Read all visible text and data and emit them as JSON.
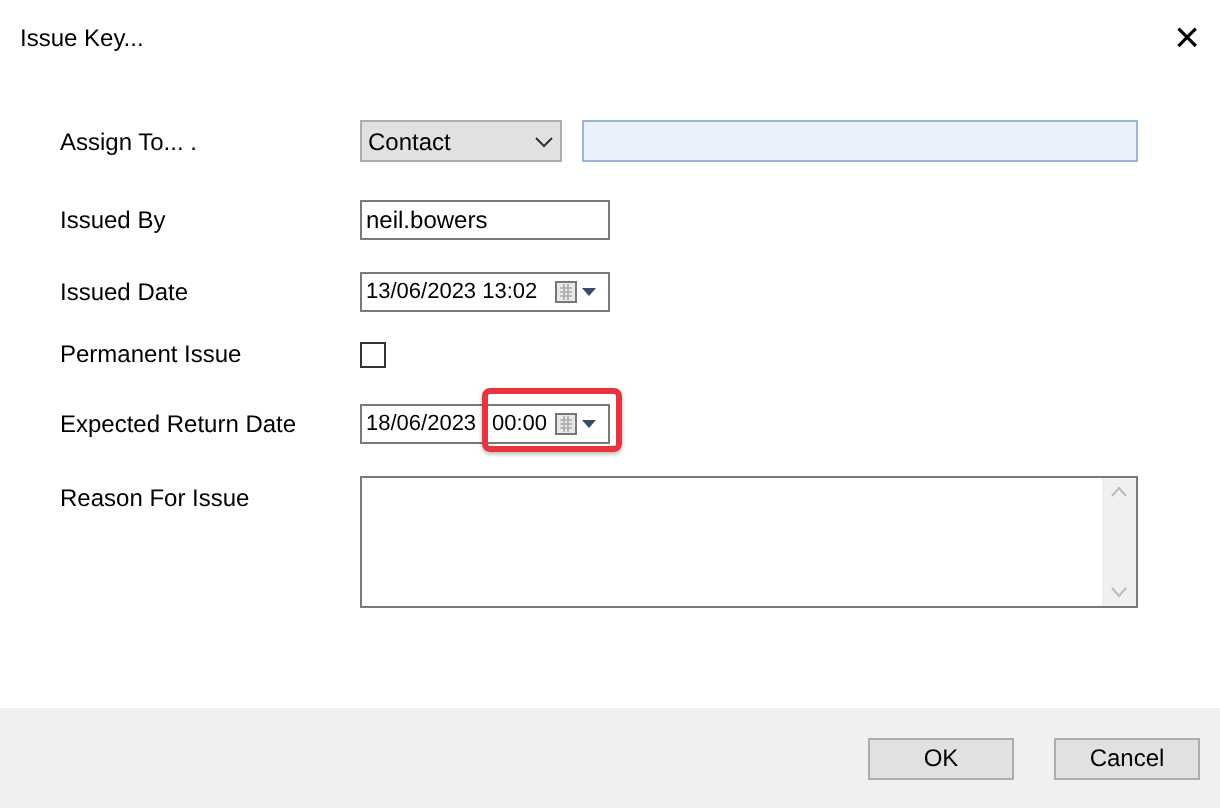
{
  "window": {
    "title": "Issue Key...",
    "close": "×"
  },
  "fields": [
    {
      "kind": "combo",
      "label": "Assign To... .",
      "value": "Contact"
    },
    {
      "kind": "text",
      "label": "Issued By",
      "value": "neil.bowers"
    },
    {
      "kind": "datetime",
      "label": "Issued Date",
      "value": "13/06/2023 13:02",
      "highlight": false
    },
    {
      "kind": "checkbox",
      "label": "Permanent Issue",
      "checked": false
    },
    {
      "kind": "datetime",
      "label": "Expected Return Date",
      "date": "18/06/2023",
      "time": "00:00",
      "highlight": true
    },
    {
      "kind": "textarea",
      "label": "Reason For Issue"
    }
  ],
  "buttons": [
    "OK",
    "Cancel"
  ]
}
